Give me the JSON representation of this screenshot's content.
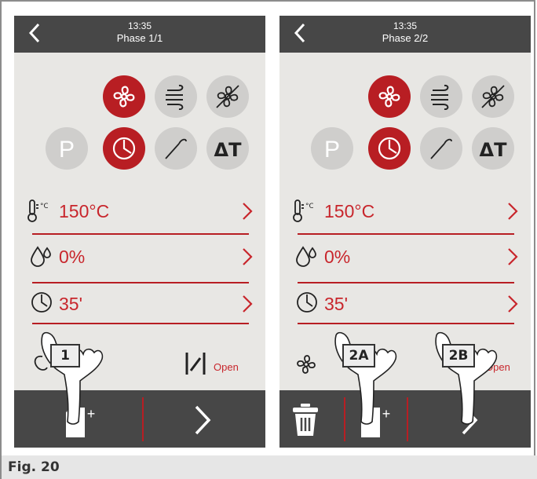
{
  "caption": "Fig. 20",
  "screens": [
    {
      "time": "13:35",
      "phase": "Phase 1/1",
      "temperature": "150°C",
      "humidity": "0%",
      "duration": "35'",
      "vent_label": "Open",
      "callouts": [
        "1"
      ]
    },
    {
      "time": "13:35",
      "phase": "Phase 2/2",
      "temperature": "150°C",
      "humidity": "0%",
      "duration": "35'",
      "vent_label": "Open",
      "callouts": [
        "2A",
        "2B"
      ]
    }
  ],
  "colors": {
    "accent": "#b81e23",
    "bar": "#474747",
    "screen_bg": "#e8e7e4",
    "inactive": "#cfcecc"
  },
  "icons": [
    "back-chevron-icon",
    "fan-icon",
    "steam-icon",
    "fan-off-icon",
    "program-p-icon",
    "timer-icon",
    "core-probe-icon",
    "delta-t-icon",
    "thermometer-icon",
    "humidity-drop-icon",
    "clock-icon",
    "vent-valve-icon",
    "add-phase-icon",
    "next-chevron-icon",
    "trash-icon",
    "pointing-hand-icon"
  ]
}
